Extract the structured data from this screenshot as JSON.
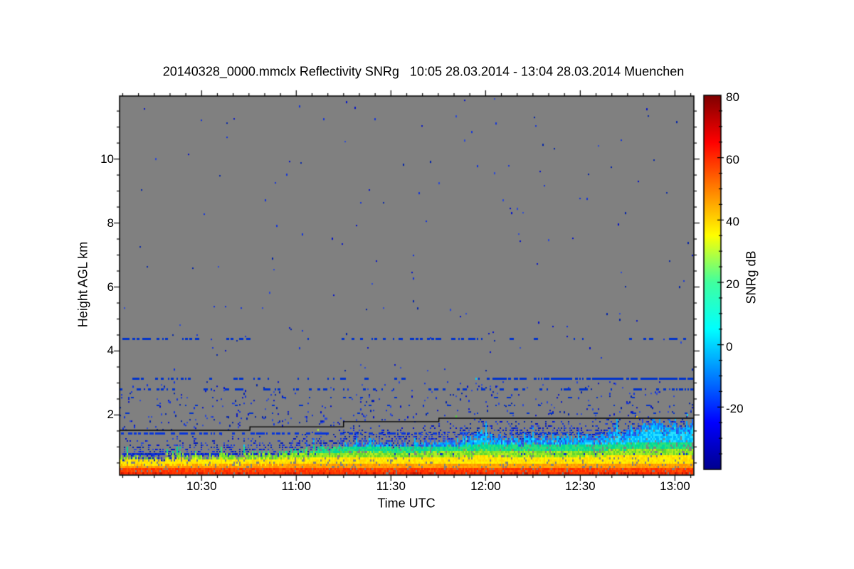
{
  "title": "20140328_0000.mmclx Reflectivity SNRg   10:05 28.03.2014 - 13:04 28.03.2014 Muenchen",
  "chart_data": {
    "type": "heatmap",
    "title": "20140328_0000.mmclx Reflectivity SNRg   10:05 28.03.2014 - 13:04 28.03.2014 Muenchen",
    "xlabel": "Time UTC",
    "ylabel": "Height AGL km",
    "background_color": "#808080",
    "x_axis": {
      "start": "10:04",
      "end": "13:06",
      "major_ticks": [
        "10:30",
        "11:00",
        "11:30",
        "12:00",
        "12:30",
        "13:00"
      ],
      "minor_step_min": 5
    },
    "y_axis": {
      "min": 0.12,
      "max": 11.97,
      "major_ticks": [
        2,
        4,
        6,
        8,
        10
      ],
      "minor_step": 0.5
    },
    "colorbar": {
      "label": "SNRg dB",
      "min": -40,
      "max": 80,
      "labeled_ticks": [
        80,
        60,
        40,
        20,
        0,
        -20
      ],
      "minor_step": 5,
      "jet_stops": [
        {
          "f": 0.0,
          "c": "#00008f"
        },
        {
          "f": 0.125,
          "c": "#0000ff"
        },
        {
          "f": 0.375,
          "c": "#00ffff"
        },
        {
          "f": 0.5,
          "c": "#40ff9f"
        },
        {
          "f": 0.625,
          "c": "#ffff00"
        },
        {
          "f": 0.875,
          "c": "#ff0000"
        },
        {
          "f": 1.0,
          "c": "#7f0000"
        }
      ]
    },
    "step_line": {
      "color": "#000000",
      "points": [
        [
          0.0,
          1.52
        ],
        [
          0.227,
          1.52
        ],
        [
          0.227,
          1.63
        ],
        [
          0.39,
          1.63
        ],
        [
          0.39,
          1.79
        ],
        [
          0.556,
          1.79
        ],
        [
          0.556,
          1.9
        ],
        [
          1.0,
          1.9
        ]
      ]
    },
    "boundary_layer": {
      "top_profile": [
        [
          0.0,
          0.62
        ],
        [
          0.05,
          0.6
        ],
        [
          0.1,
          0.62
        ],
        [
          0.15,
          0.68
        ],
        [
          0.2,
          0.72
        ],
        [
          0.25,
          0.75
        ],
        [
          0.3,
          0.82
        ],
        [
          0.35,
          0.95
        ],
        [
          0.4,
          1.05
        ],
        [
          0.44,
          1.18
        ],
        [
          0.48,
          1.0
        ],
        [
          0.52,
          1.1
        ],
        [
          0.56,
          1.22
        ],
        [
          0.6,
          1.15
        ],
        [
          0.63,
          1.45
        ],
        [
          0.66,
          1.3
        ],
        [
          0.7,
          1.25
        ],
        [
          0.74,
          1.35
        ],
        [
          0.78,
          1.28
        ],
        [
          0.82,
          1.35
        ],
        [
          0.86,
          1.45
        ],
        [
          0.9,
          1.55
        ],
        [
          0.93,
          1.85
        ],
        [
          0.95,
          1.55
        ],
        [
          0.97,
          1.65
        ],
        [
          1.0,
          1.7
        ]
      ],
      "colors": {
        "red_dark": [
          "#e02000",
          "#c41400"
        ],
        "red": [
          "#ff5a00",
          "#ff3c00",
          "#ff2a00"
        ],
        "orange": [
          "#ffaa00",
          "#ff9000"
        ],
        "yellow": [
          "#ffe800",
          "#fff400",
          "#ffd400"
        ],
        "green": [
          "#8ce628",
          "#b4ee20",
          "#5fd830"
        ],
        "teal": [
          "#00d89a",
          "#2ee07a"
        ],
        "cyan": [
          "#00c8ff",
          "#00b0ff",
          "#28e0ff"
        ],
        "edge": [
          "#1e6cf0",
          "#00a6ff",
          "#2e4ae0",
          "#00c2ff"
        ]
      }
    },
    "speckle_colors": [
      "#0011cc",
      "#1133dd",
      "#0022aa",
      "#2b49d8"
    ],
    "bands": [
      {
        "h": 3.15,
        "th": 3,
        "color": "#0033cc",
        "segments": [
          {
            "f0": 0,
            "f1": 0.12,
            "d": 0.3
          },
          {
            "f0": 0.12,
            "f1": 0.3,
            "d": 0.1
          },
          {
            "f0": 0.3,
            "f1": 0.42,
            "d": 0.18
          },
          {
            "f0": 0.42,
            "f1": 0.62,
            "d": 0.08
          },
          {
            "f0": 0.62,
            "f1": 0.75,
            "d": 0.35
          },
          {
            "f0": 0.75,
            "f1": 1.0,
            "d": 0.68
          }
        ]
      },
      {
        "h": 2.8,
        "th": 3,
        "color": "#0033cc",
        "segments": [
          {
            "f0": 0,
            "f1": 0.8,
            "d": 0.15
          },
          {
            "f0": 0.8,
            "f1": 1.0,
            "d": 0.25
          }
        ]
      },
      {
        "h": 2.55,
        "th": 2,
        "color": "#0033cc",
        "segments": [
          {
            "f0": 0,
            "f1": 1.0,
            "d": 0.06
          }
        ]
      },
      {
        "h": 4.38,
        "th": 3,
        "color": "#0033cc",
        "segments": [
          {
            "f0": 0,
            "f1": 0.13,
            "d": 0.28
          },
          {
            "f0": 0.13,
            "f1": 0.38,
            "d": 0.05
          },
          {
            "f0": 0.38,
            "f1": 0.63,
            "d": 0.16
          },
          {
            "f0": 0.63,
            "f1": 0.84,
            "d": 0.04
          },
          {
            "f0": 0.84,
            "f1": 1.0,
            "d": 0.14
          }
        ]
      },
      {
        "h": 2.3,
        "th": 2,
        "color": "#0033cc",
        "segments": [
          {
            "f0": 0,
            "f1": 1.0,
            "d": 0.05
          }
        ]
      },
      {
        "h": 2.05,
        "th": 2,
        "color": "#0033cc",
        "segments": [
          {
            "f0": 0,
            "f1": 1.0,
            "d": 0.04
          }
        ]
      },
      {
        "h": 0.78,
        "th": 3,
        "color": "#0a2fd0",
        "segments": [
          {
            "f0": 0,
            "f1": 1.0,
            "d": 0.6
          }
        ]
      },
      {
        "h": 1.43,
        "th": 3,
        "color": "#0936d8",
        "segments": [
          {
            "f0": 0,
            "f1": 0.42,
            "d": 0.45
          },
          {
            "f0": 0.42,
            "f1": 0.75,
            "d": 0.25
          },
          {
            "f0": 0.75,
            "f1": 1.0,
            "d": 0.3
          }
        ]
      }
    ],
    "scatter_regions": [
      {
        "h0": 3.3,
        "h1": 11.9,
        "p": 0.002,
        "above_line": false
      },
      {
        "h0": 2.1,
        "h1": 3.05,
        "p": 0.025,
        "above_line": false
      },
      {
        "h0": 1.5,
        "h1": 2.05,
        "p": 0.05,
        "above_line": true
      }
    ],
    "color_specks": [
      {
        "f": 0.9,
        "h": 1.95,
        "c": "#ffcc00"
      },
      {
        "f": 0.965,
        "h": 1.6,
        "c": "#44e0c0"
      },
      {
        "f": 0.585,
        "h": 1.97,
        "c": "#55cc44"
      },
      {
        "f": 0.988,
        "h": 2.0,
        "c": "#00d8ff"
      },
      {
        "f": 0.62,
        "h": 3.15,
        "c": "#00ccff"
      },
      {
        "f": 0.345,
        "h": 1.55,
        "c": "#aaee33"
      }
    ],
    "seed": 1234
  }
}
